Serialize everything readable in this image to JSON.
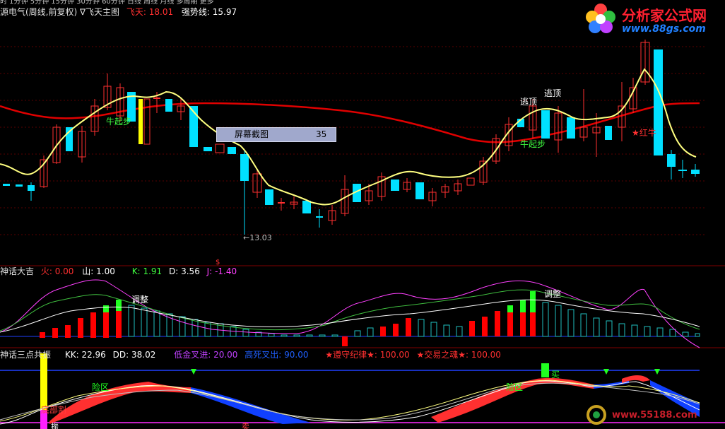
{
  "top_strip": "时  1分钟  5分钟  15分钟  30分钟  60分钟  日线  周线  月线  多周期  更多",
  "main_panel": {
    "title": "源电气(周线,前复权) ∇飞天主图",
    "feitian_label": "飞天:",
    "feitian_value": "18.01",
    "strength_label": "强势线:",
    "strength_value": "15.97",
    "annotations": {
      "niu1": "牛起步",
      "niu2": "牛起步",
      "escape1": "逃顶",
      "escape2": "逃顶",
      "red_cow": "★红牛",
      "low_price": "←13.03",
      "dollar": "$"
    },
    "colors": {
      "up": "#ff3030",
      "down": "#00e0ff",
      "ma_slow": "#e00000",
      "ma_fast": "#ffff80"
    }
  },
  "popup": {
    "label": "屏幕截图",
    "value": "35"
  },
  "logo": {
    "title": "分析家公式网",
    "url": "www.88gs.com"
  },
  "kdj_panel": {
    "title": "神话大吉",
    "fire_label": "火:",
    "fire_value": "0.00",
    "mountain_label": "山:",
    "mountain_value": "1.00",
    "k_label": "K:",
    "k_value": "1.91",
    "d_label": "D:",
    "d_value": "3.56",
    "j_label": "J:",
    "j_value": "-1.40",
    "adjust1": "调整",
    "adjust2": "调整"
  },
  "osc_panel": {
    "title": "神话三点共振",
    "kk_label": "KK:",
    "kk_value": "22.96",
    "dd_label": "DD:",
    "dd_value": "38.02",
    "low_gold_label": "低金叉进:",
    "low_gold_value": "20.00",
    "high_dead_label": "高死叉出:",
    "high_dead_value": "90.00",
    "discipline_label": "★遵守纪律★:",
    "discipline_value": "100.00",
    "soul_label": "★交易之魂★:",
    "soul_value": "100.00",
    "risk1": "险区",
    "risk2": "险区",
    "bottom_cut": "底部割",
    "vibration": "振",
    "sell_mark": "卖",
    "buy_mark": "买"
  },
  "watermark": "www.55188.com"
}
